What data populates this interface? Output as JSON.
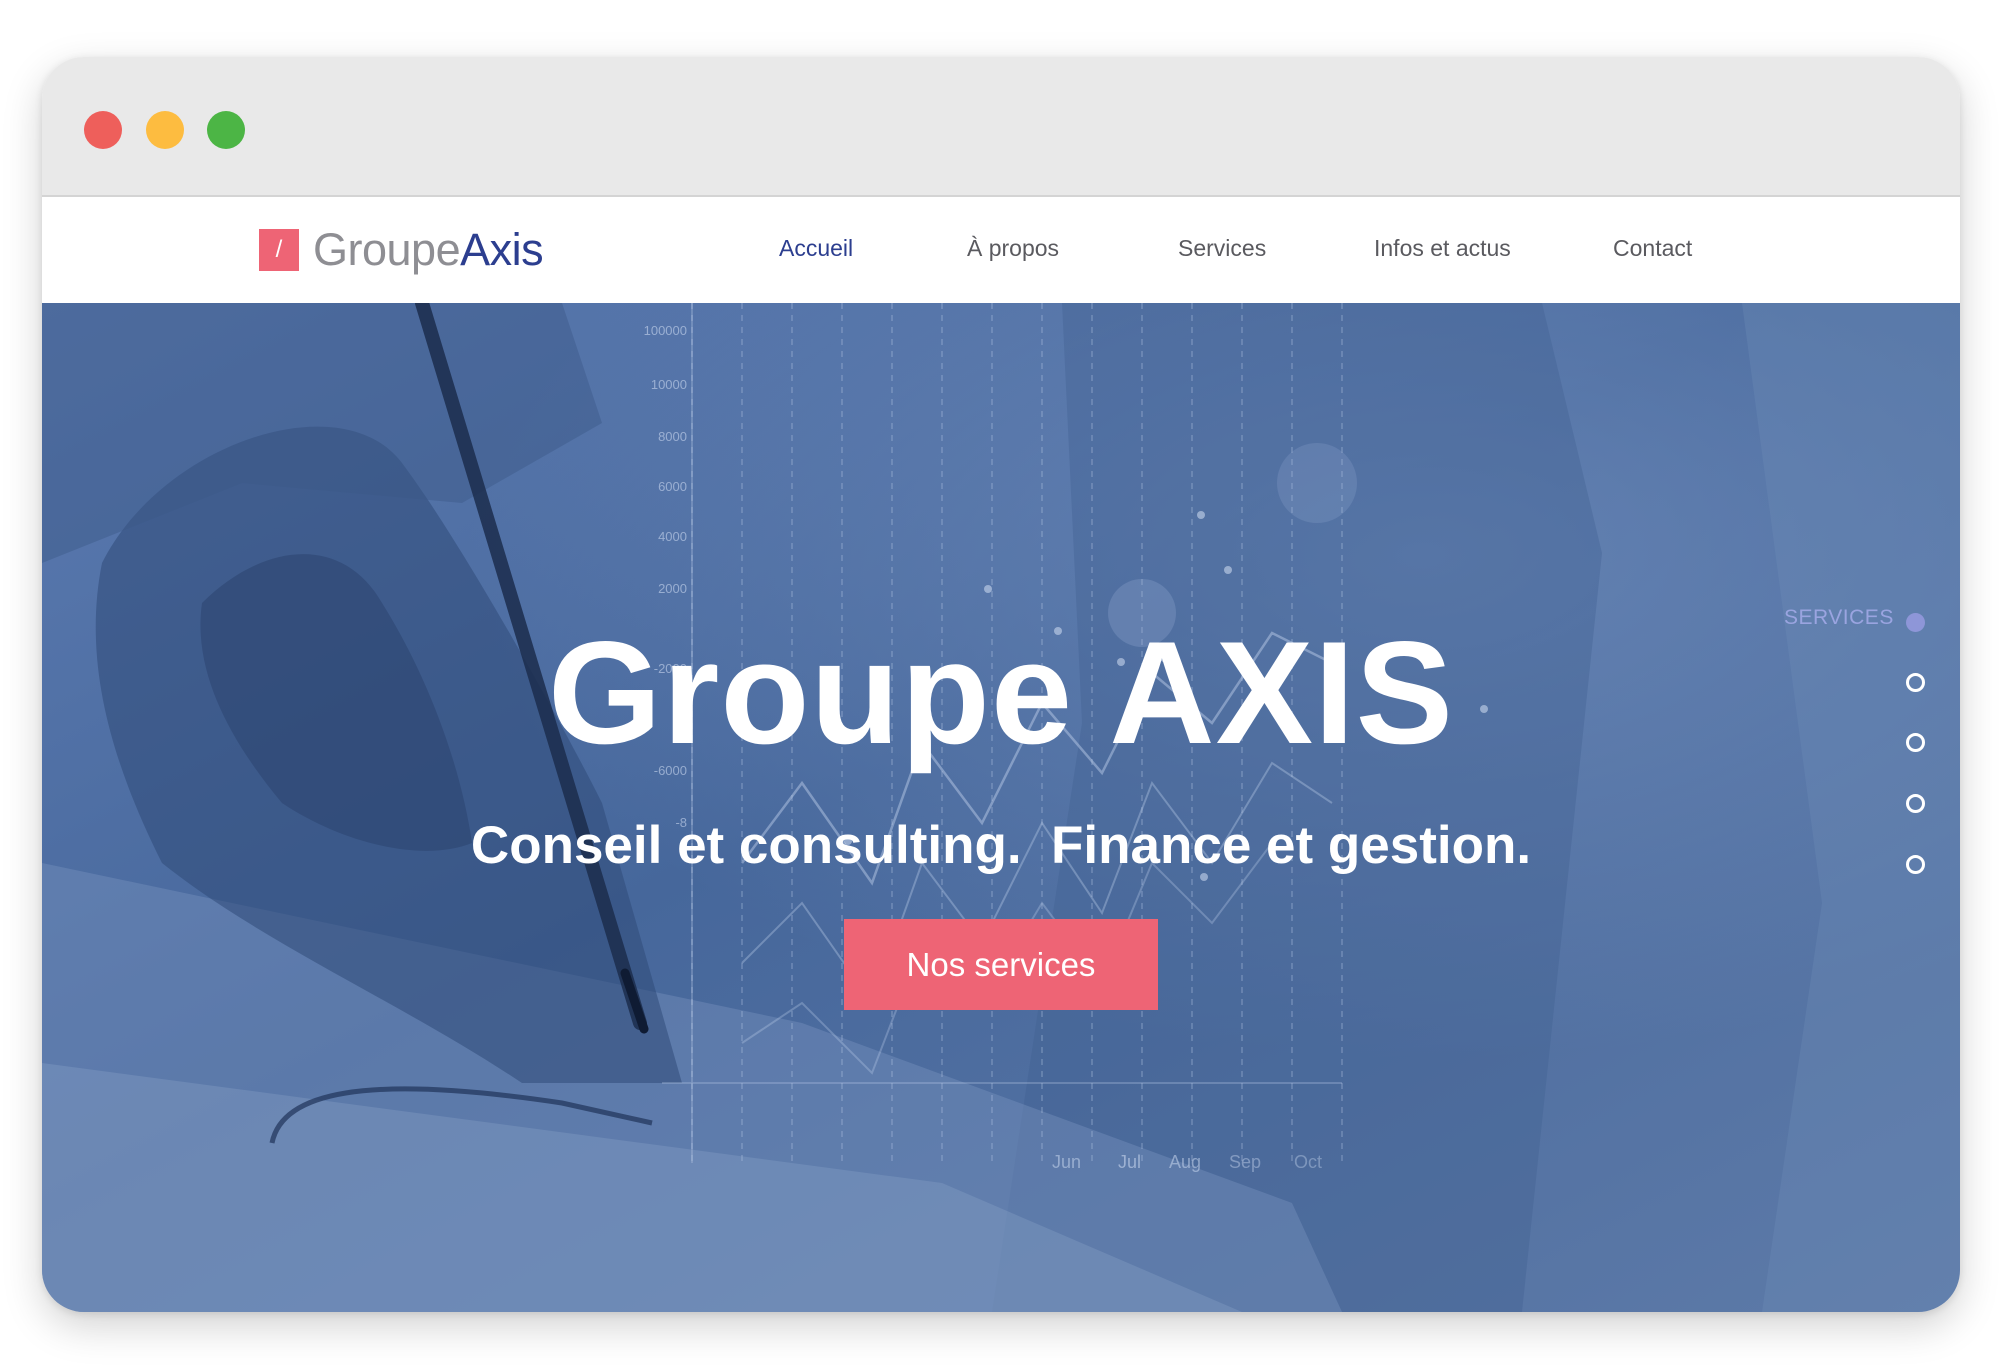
{
  "window": {
    "controls": [
      "close",
      "minimize",
      "zoom"
    ],
    "colors": {
      "close": "#ee5f5b",
      "minimize": "#fdbc40",
      "zoom": "#4cb545"
    }
  },
  "brand": {
    "icon_glyph": "/",
    "name_part1": "Groupe",
    "name_part2": "Axis",
    "colors": {
      "mark": "#ee6475",
      "part1": "#8e8e93",
      "part2": "#2c3e8f"
    }
  },
  "nav": {
    "items": [
      {
        "label": "Accueil",
        "active": true
      },
      {
        "label": "À propos",
        "active": false
      },
      {
        "label": "Services",
        "active": false
      },
      {
        "label": "Infos et actus",
        "active": false
      },
      {
        "label": "Contact",
        "active": false
      }
    ],
    "colors": {
      "active": "#2c3e8f",
      "default": "#5a5a5f"
    }
  },
  "hero": {
    "title": "Groupe AXIS",
    "subtitle": "Conseil et consulting.  Finance et gestion.",
    "cta_label": "Nos services",
    "overlay_color": "#4b6ea2",
    "cta_color": "#ee6475",
    "background_chart": {
      "y_ticks": [
        "100000",
        "10000",
        "8000",
        "6000",
        "4000",
        "2000",
        "-2000",
        "-6000",
        "-8"
      ],
      "x_ticks": [
        "Jun",
        "Jul",
        "Aug",
        "Sep",
        "Oct"
      ]
    }
  },
  "section_nav": {
    "active_label": "SERVICES",
    "dot_count": 5,
    "active_index": 0,
    "colors": {
      "active": "#8e96d8",
      "label": "#9aa4e0"
    }
  }
}
